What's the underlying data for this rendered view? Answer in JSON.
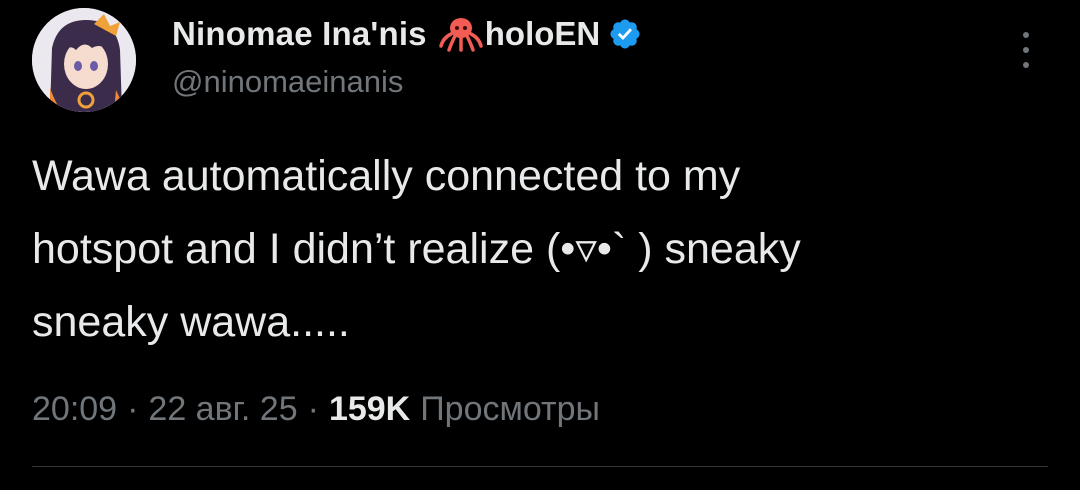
{
  "author": {
    "display_name": "Ninomae Ina'nis",
    "name_emoji": "octopus-icon",
    "org_label": "holoEN",
    "verified": true,
    "handle": "@ninomaeinanis"
  },
  "tweet": {
    "text": "Wawa automatically connected to my\nhotspot and I didn’t realize (•▿•` ) sneaky\nsneaky wawa....."
  },
  "meta": {
    "time": "20:09",
    "separator": "·",
    "date": "22 авг. 25",
    "views_count": "159K",
    "views_label": "Просмотры"
  },
  "colors": {
    "background": "#000000",
    "text_primary": "#e7e9ea",
    "text_secondary": "#71767b",
    "verified_blue": "#1d9bf0",
    "octopus_red": "#f25c54",
    "divider": "#2f3336"
  },
  "icons": {
    "more": "more-vertical-icon",
    "verified": "verified-badge-icon",
    "avatar": "profile-avatar"
  }
}
